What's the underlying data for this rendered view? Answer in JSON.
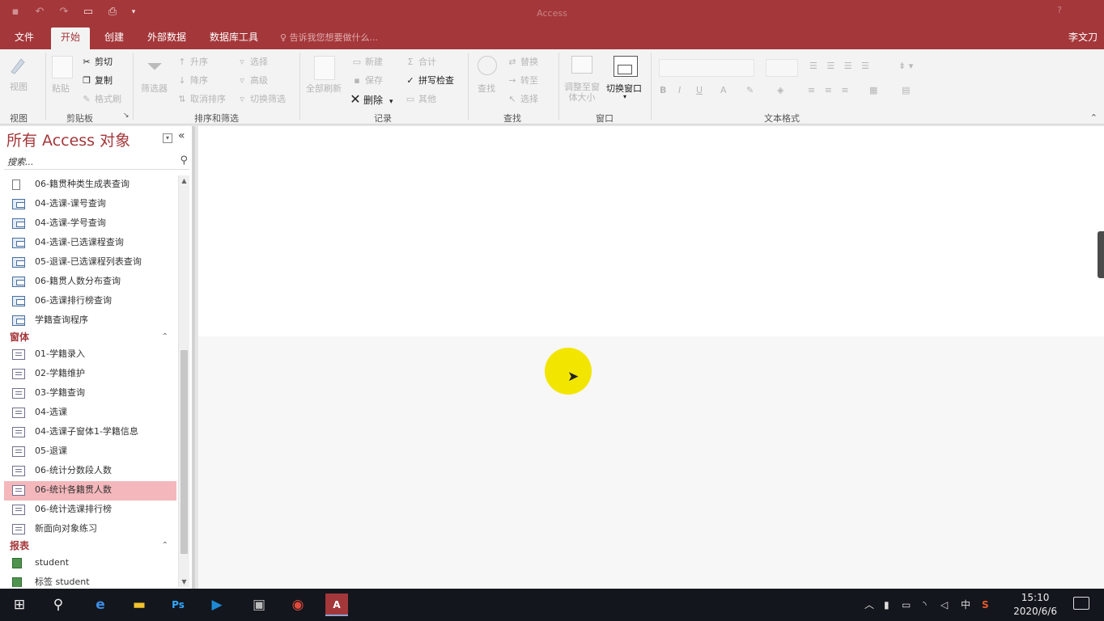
{
  "window": {
    "title": "Access"
  },
  "qat": {
    "icons": [
      "save-icon",
      "undo-icon",
      "redo-icon",
      "open-folder-icon",
      "print-preview-icon",
      "customize-qat-icon"
    ]
  },
  "tabs": [
    {
      "label": "文件"
    },
    {
      "label": "开始"
    },
    {
      "label": "创建"
    },
    {
      "label": "外部数据"
    },
    {
      "label": "数据库工具"
    }
  ],
  "tellme": "告诉我您想要做什么...",
  "user": "李文刀",
  "ribbon": {
    "view": {
      "label": "视图"
    },
    "clipboard": {
      "paste": "粘贴",
      "cut": "剪切",
      "copy": "复制",
      "format_painter": "格式刷"
    },
    "sort_filter": {
      "filter": "筛选器",
      "asc": "升序",
      "desc": "降序",
      "remove_sort": "取消排序",
      "selection": "选择",
      "advanced": "高级",
      "toggle_filter": "切换筛选"
    },
    "records": {
      "refresh_all": "全部刷新",
      "new": "新建",
      "save": "保存",
      "delete": "删除",
      "totals": "合计",
      "spelling": "拼写检查",
      "more": "其他"
    },
    "find": {
      "find": "查找",
      "replace": "替换",
      "goto": "转至",
      "select": "选择"
    },
    "window": {
      "fit": "调整至窗体大小",
      "switch": "切换窗口"
    },
    "text_format": {
      "bold": "B",
      "italic": "I",
      "underline": "U"
    },
    "groups": [
      "视图",
      "剪贴板",
      "排序和筛选",
      "记录",
      "查找",
      "窗口",
      "文本格式"
    ]
  },
  "nav": {
    "title": "所有 Access 对象",
    "search_placeholder": "搜索...",
    "top_items": [
      {
        "label": "06-籍贯种类生成表查询",
        "icon": "make-table-query-icon"
      },
      {
        "label": "04-选课-课号查询",
        "icon": "query-icon"
      },
      {
        "label": "04-选课-学号查询",
        "icon": "query-icon"
      },
      {
        "label": "04-选课-已选课程查询",
        "icon": "query-icon"
      },
      {
        "label": "05-退课-已选课程列表查询",
        "icon": "query-icon"
      },
      {
        "label": "06-籍贯人数分布查询",
        "icon": "query-icon"
      },
      {
        "label": "06-选课排行榜查询",
        "icon": "query-icon"
      },
      {
        "label": "学籍查询程序",
        "icon": "query-icon"
      }
    ],
    "forms_header": "窗体",
    "forms": [
      {
        "label": "01-学籍录入"
      },
      {
        "label": "02-学籍维护"
      },
      {
        "label": "03-学籍查询"
      },
      {
        "label": "04-选课"
      },
      {
        "label": "04-选课子窗体1-学籍信息"
      },
      {
        "label": "05-退课"
      },
      {
        "label": "06-统计分数段人数"
      },
      {
        "label": "06-统计各籍贯人数",
        "selected": true
      },
      {
        "label": "06-统计选课排行榜"
      },
      {
        "label": "新面向对象练习"
      }
    ],
    "reports_header": "报表",
    "reports": [
      {
        "label": "student"
      },
      {
        "label": "标签 student"
      }
    ]
  },
  "taskbar": {
    "apps": [
      "start-icon",
      "search-icon",
      "edge-icon",
      "file-explorer-icon",
      "photoshop-icon",
      "media-player-icon",
      "app-icon",
      "chrome-icon",
      "access-icon"
    ],
    "ime": "中",
    "time": "15:10",
    "date": "2020/6/6"
  },
  "colors": {
    "accent": "#a4373a",
    "selection": "#f4b8bc",
    "cursor_highlight": "#f2e600"
  }
}
